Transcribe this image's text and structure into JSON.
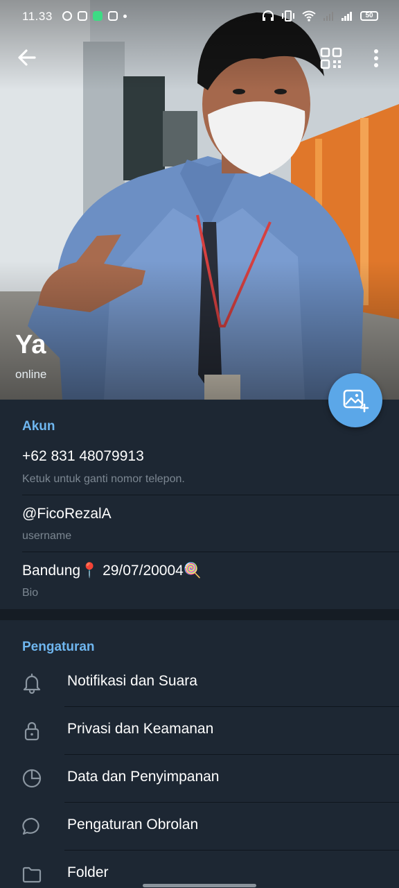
{
  "status_bar": {
    "time": "11.33",
    "battery": "50"
  },
  "profile": {
    "name": "Ya",
    "status": "online"
  },
  "account": {
    "header": "Akun",
    "phone": "+62 831 48079913",
    "phone_hint": "Ketuk untuk ganti nomor telepon.",
    "username": "@FicoRezalA",
    "username_label": "username",
    "bio": "Bandung📍 29/07/20004🍭",
    "bio_label": "Bio"
  },
  "settings": {
    "header": "Pengaturan",
    "items": [
      {
        "label": "Notifikasi dan Suara",
        "icon": "bell-icon"
      },
      {
        "label": "Privasi dan Keamanan",
        "icon": "lock-icon"
      },
      {
        "label": "Data dan Penyimpanan",
        "icon": "pie-chart-icon"
      },
      {
        "label": "Pengaturan Obrolan",
        "icon": "chat-bubble-icon"
      },
      {
        "label": "Folder",
        "icon": "folder-icon"
      }
    ]
  },
  "colors": {
    "background": "#1d2733",
    "accent": "#6fb6ef",
    "fab": "#5ba7e8"
  }
}
